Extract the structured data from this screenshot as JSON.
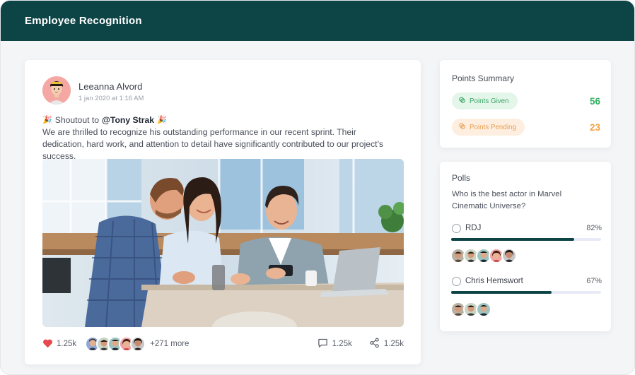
{
  "app": {
    "title": "Employee Recognition"
  },
  "post": {
    "author": "Leeanna Alvord",
    "timestamp": "1 jan 2020 at 1:16 AM",
    "shoutout_prefix": "Shoutout to",
    "mention": "@Tony Strak",
    "body": "We are thrilled to recognize his outstanding performance in our recent sprint. Their dedication, hard work, and attention to detail have significantly contributed to our project's success.",
    "likes": "1.25k",
    "more_likers": "+271 more",
    "comments": "1.25k",
    "shares": "1.25k",
    "icons": [
      "party-popper-icon",
      "heart-icon",
      "comment-icon",
      "share-icon"
    ]
  },
  "points_summary": {
    "title": "Points Summary",
    "given_label": "Points Given",
    "given_value": "56",
    "pending_label": "Points Pending",
    "pending_value": "23"
  },
  "polls": {
    "title": "Polls",
    "question": "Who is the best actor in Marvel Cinematic Universe?",
    "options": [
      {
        "label": "RDJ",
        "percent": "82%",
        "fraction": 0.82
      },
      {
        "label": "Chris Hemswort",
        "percent": "67%",
        "fraction": 0.67
      }
    ]
  },
  "colors": {
    "header": "#0d4446",
    "accent": "#0d4446",
    "like": "#e5484d",
    "given": "#34b063",
    "pending": "#f0a448"
  }
}
